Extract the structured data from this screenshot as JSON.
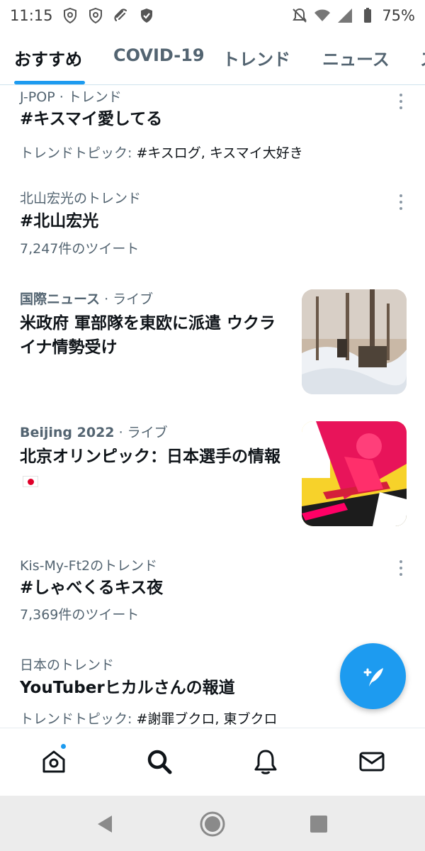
{
  "status_bar": {
    "time": "11:15",
    "battery": "75%",
    "left_icons": [
      "shield-icon",
      "shield-icon",
      "link-icon",
      "shield-check-icon"
    ],
    "right_icons": [
      "notifications-off-icon",
      "wifi-icon",
      "signal-icon",
      "battery-icon"
    ]
  },
  "tabs": [
    {
      "label": "おすすめ",
      "active": true
    },
    {
      "label": "COVID-19",
      "active": false
    },
    {
      "label": "トレンド",
      "active": false
    },
    {
      "label": "ニュース",
      "active": false
    },
    {
      "label": "ス",
      "active": false
    }
  ],
  "feed": [
    {
      "meta": "J-POP · トレンド",
      "title": "#キスマイ愛してる",
      "sub_prefix": "トレンドトピック: ",
      "sub_value": "#キスログ, キスマイ大好き",
      "has_more": true
    },
    {
      "meta": "北山宏光のトレンド",
      "title": "#北山宏光",
      "sub": "7,247件のツイート",
      "has_more": true
    },
    {
      "meta_strong": "国際ニュース",
      "meta_suffix": " · ライブ",
      "title": "米政府 軍部隊を東欧に派遣 ウクライナ情勢受け",
      "thumbnail": "snowy-forest-photo"
    },
    {
      "meta_strong": "Beijing 2022",
      "meta_suffix": " · ライブ",
      "title": "北京オリンピック：日本選手の情報",
      "emoji": "japan-flag-icon",
      "thumbnail": "ski-jumper-illustration"
    },
    {
      "meta": "Kis-My-Ft2のトレンド",
      "title": "#しゃべくるキス夜",
      "sub": "7,369件のツイート",
      "has_more": true
    },
    {
      "meta": "日本のトレンド",
      "title": "YouTuberヒカルさんの報道",
      "sub_prefix": "トレンドトピック: ",
      "sub_value": "#謝罪ブクロ, 東ブクロ"
    }
  ],
  "fab": {
    "icon": "compose-tweet-icon"
  },
  "bottom_nav": [
    "home-icon",
    "search-icon",
    "notifications-icon",
    "messages-icon"
  ],
  "colors": {
    "accent": "#1d9bf0",
    "secondary_text": "#536471",
    "primary_text": "#0f1419"
  }
}
